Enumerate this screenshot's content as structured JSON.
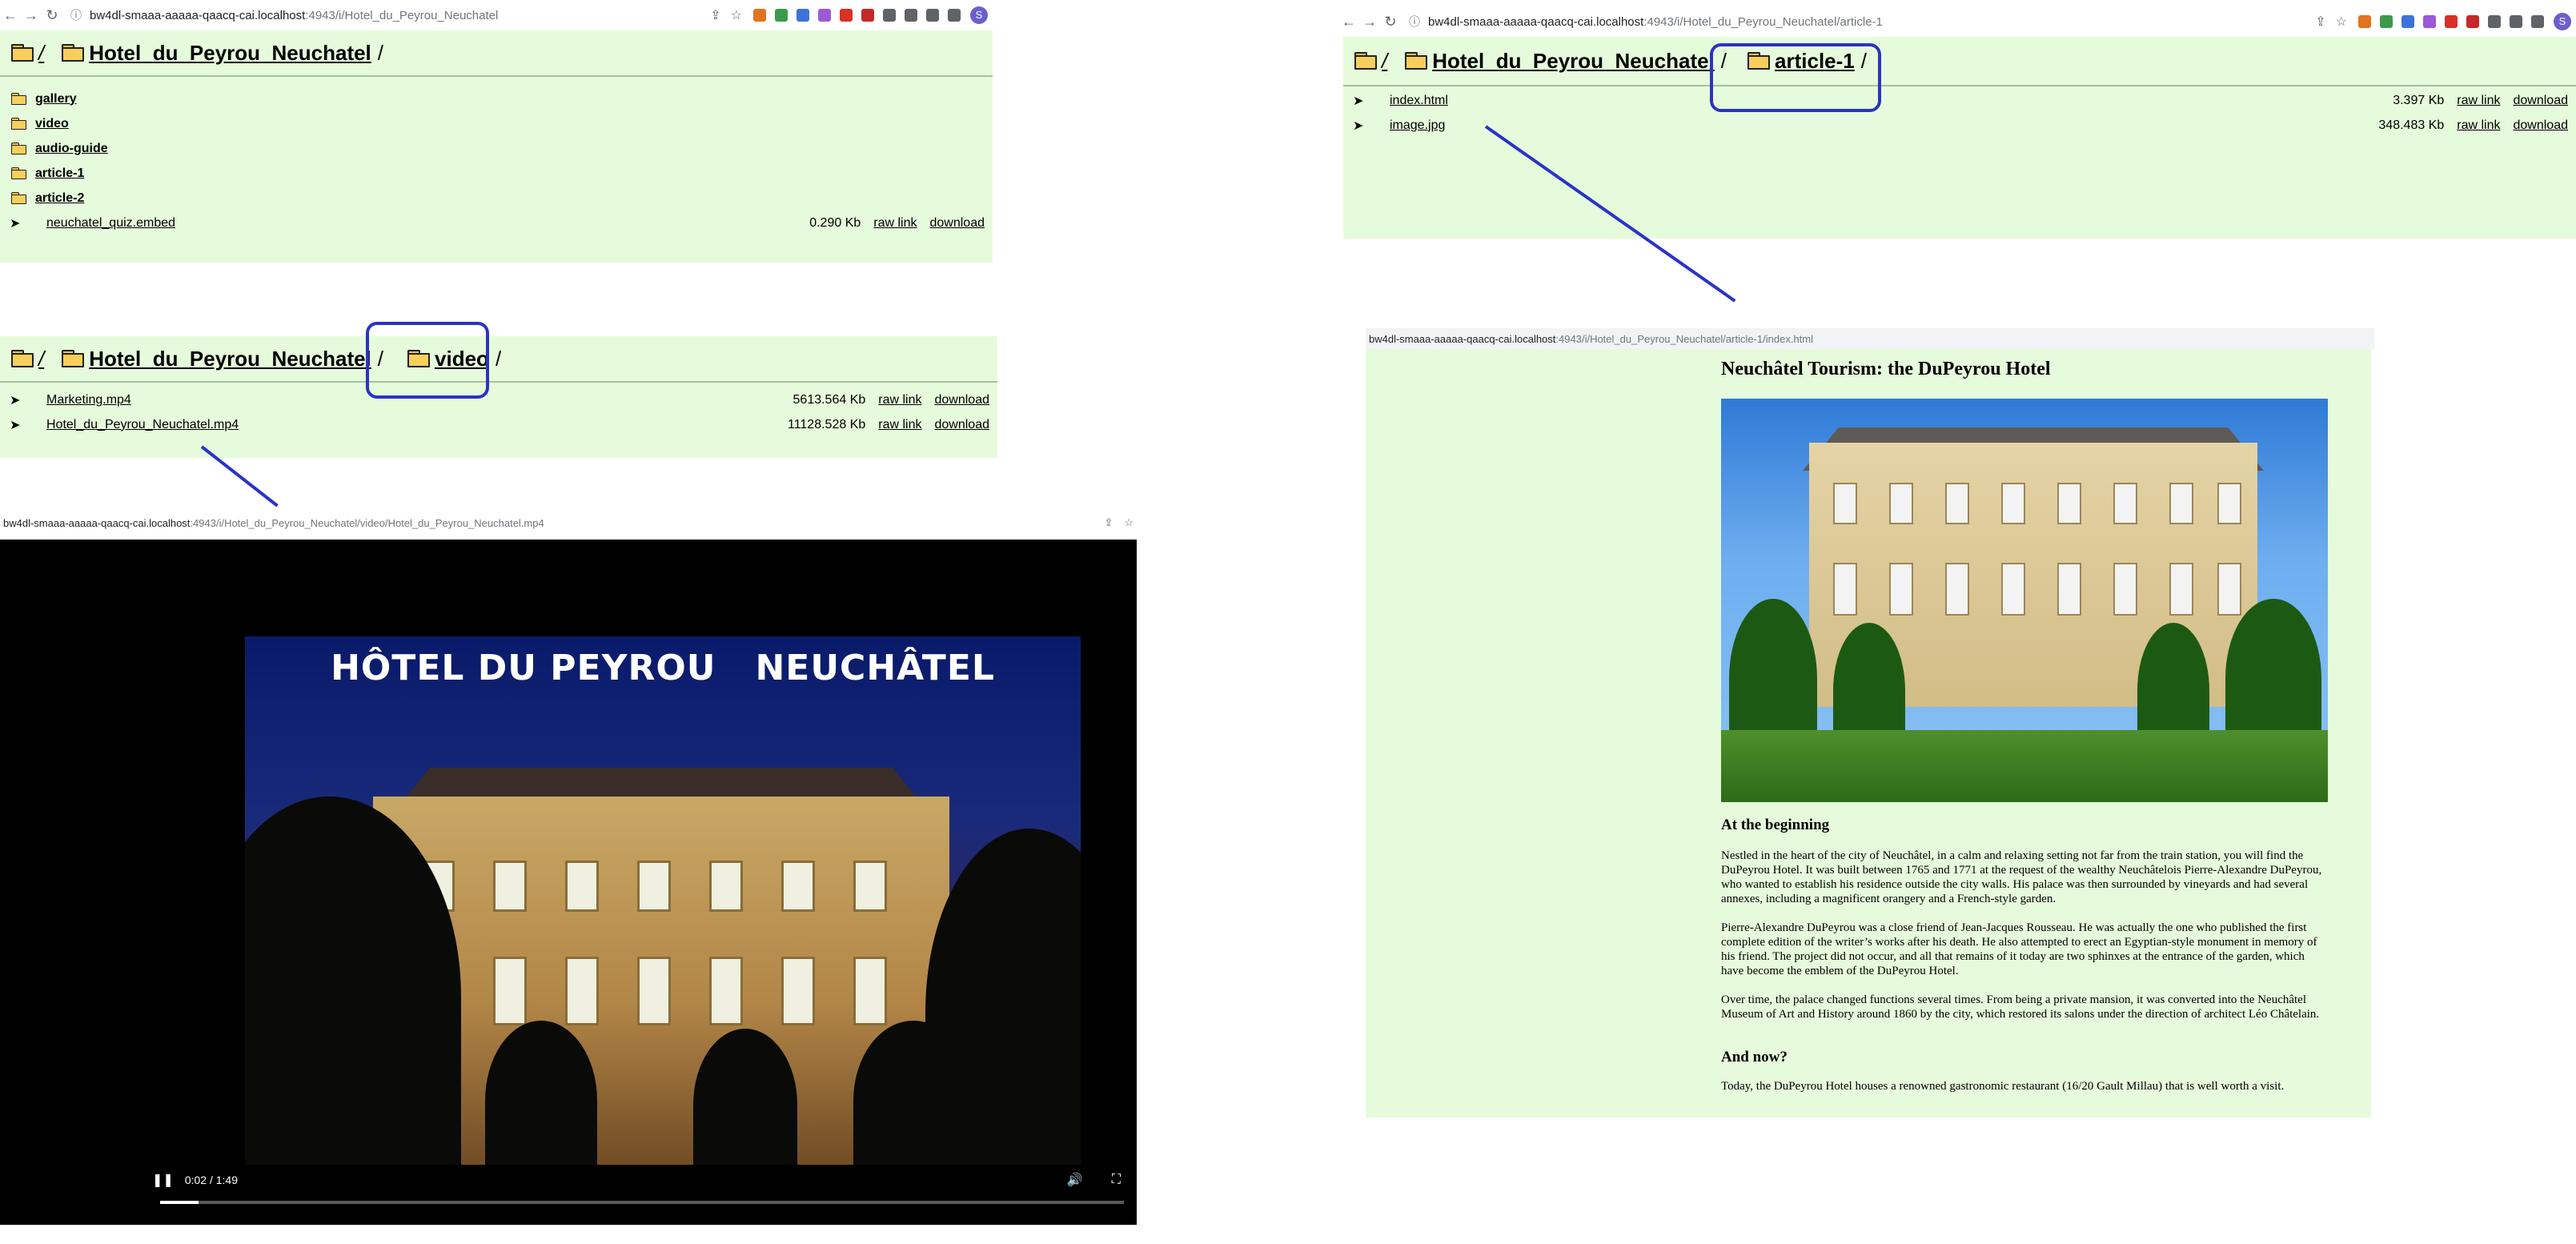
{
  "window_root": {
    "url_host": "bw4dl-smaaa-aaaaa-qaacq-cai.localhost",
    "url_path": ":4943/i/Hotel_du_Peyrou_Neuchatel",
    "crumb_root": "/",
    "crumb_folder": "Hotel_du_Peyrou_Neuchatel",
    "crumb_trailing": "/",
    "folders": [
      "gallery",
      "video",
      "audio-guide",
      "article-1",
      "article-2"
    ],
    "files": [
      {
        "arrow": "➤",
        "name": "neuchatel_quiz.embed",
        "size": "0.290 Kb",
        "raw": "raw link",
        "dl": "download"
      }
    ]
  },
  "window_video_dir": {
    "crumb_root": "/",
    "crumb_folder": "Hotel_du_Peyrou_Neuchatel",
    "crumb_sub": "video",
    "crumb_trailing": "/",
    "files": [
      {
        "arrow": "➤",
        "name": "Marketing.mp4",
        "size": "5613.564 Kb",
        "raw": "raw link",
        "dl": "download"
      },
      {
        "arrow": "➤",
        "name": "Hotel_du_Peyrou_Neuchatel.mp4",
        "size": "11128.528 Kb",
        "raw": "raw link",
        "dl": "download"
      }
    ]
  },
  "video_player": {
    "url_host": "bw4dl-smaaa-aaaaa-qaacq-cai.localhost",
    "url_path": ":4943/i/Hotel_du_Peyrou_Neuchatel/video/Hotel_du_Peyrou_Neuchatel.mp4",
    "overlay_title": "HÔTEL DU PEYROU   NEUCHÂTEL",
    "time": "0:02 / 1:49",
    "progress_fraction": 0.04
  },
  "window_article_dir": {
    "url_host": "bw4dl-smaaa-aaaaa-qaacq-cai.localhost",
    "url_path": ":4943/i/Hotel_du_Peyrou_Neuchatel/article-1",
    "crumb_root": "/",
    "crumb_folder": "Hotel_du_Peyrou_Neuchatel",
    "crumb_sub": "article-1",
    "crumb_trailing": "/",
    "files": [
      {
        "arrow": "➤",
        "name": "index.html",
        "size": "3.397 Kb",
        "raw": "raw link",
        "dl": "download"
      },
      {
        "arrow": "➤",
        "name": "image.jpg",
        "size": "348.483 Kb",
        "raw": "raw link",
        "dl": "download"
      }
    ]
  },
  "article_page": {
    "url_host": "bw4dl-smaaa-aaaaa-qaacq-cai.localhost",
    "url_path": ":4943/i/Hotel_du_Peyrou_Neuchatel/article-1/index.html",
    "title": "Neuchâtel Tourism: the DuPeyrou Hotel",
    "h_beginning": "At the beginning",
    "p1": "Nestled in the heart of the city of Neuchâtel, in a calm and relaxing setting not far from the train station, you will find the DuPeyrou Hotel. It was built between 1765 and 1771 at the request of the wealthy Neuchâtelois Pierre-Alexandre DuPeyrou, who wanted to establish his residence outside the city walls. His palace was then surrounded by vineyards and had several annexes, including a magnificent orangery and a French-style garden.",
    "p2": "Pierre-Alexandre DuPeyrou was a close friend of Jean-Jacques Rousseau. He was actually the one who published the first complete edition of the writer’s works after his death. He also attempted to erect an Egyptian-style monument in memory of his friend. The project did not occur, and all that remains of it today are two sphinxes at the entrance of the garden, which have become the emblem of the DuPeyrou Hotel.",
    "p3": "Over time, the palace changed functions several times. From being a private mansion, it was converted into the Neuchâtel Museum of Art and History around 1860 by the city, which restored its salons under the direction of architect Léo Châtelain.",
    "h_now": "And now?",
    "p4": "Today, the DuPeyrou Hotel houses a renowned gastronomic restaurant (16/20 Gault Millau) that is well worth a visit."
  },
  "chrome": {
    "avatar_letter": "S"
  },
  "colors": {
    "panel_bg": "#e6fbdb",
    "highlight": "#2b33c8"
  }
}
